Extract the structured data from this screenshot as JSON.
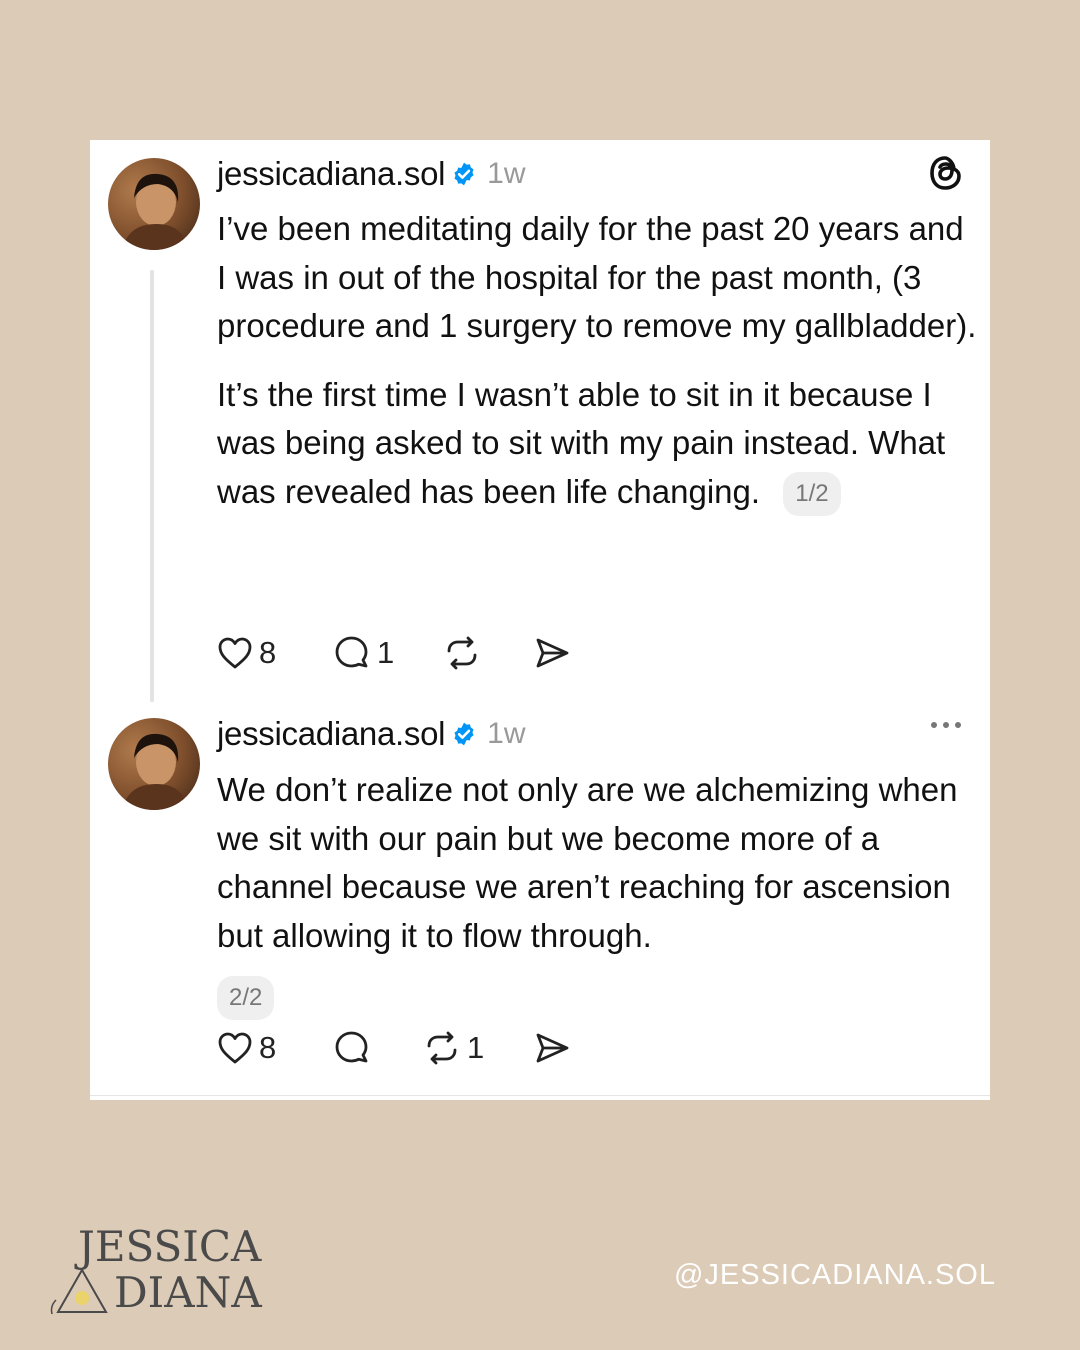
{
  "posts": [
    {
      "username": "jessicadiana.sol",
      "time": "1w",
      "paragraphs": [
        "I’ve been meditating daily for the past 20 years and I was in out of the hospital for the past month, (3 procedure and 1 surgery to remove my gallbladder).",
        " It’s the first time I wasn’t able to sit in it because I was being asked to sit with my pain instead. What was revealed has been life changing."
      ],
      "pager": "1/2",
      "likes": "8",
      "replies": "1",
      "reposts": "",
      "top_icon": "threads-logo-icon"
    },
    {
      "username": "jessicadiana.sol",
      "time": "1w",
      "paragraphs": [
        "We don’t realize not only are we alchemizing when we sit with our pain but we become more of a channel because we aren’t reaching for ascension but allowing it to flow through."
      ],
      "pager": "2/2",
      "likes": "8",
      "replies": "",
      "reposts": "1",
      "top_icon": "more-options-icon"
    }
  ],
  "brand": {
    "line1": "JESSICA",
    "line2": "DIANA",
    "handle": "@JESSICADIANA.SOL"
  },
  "colors": {
    "background": "#dccbb6",
    "card": "#ffffff",
    "verified": "#0095f6"
  }
}
